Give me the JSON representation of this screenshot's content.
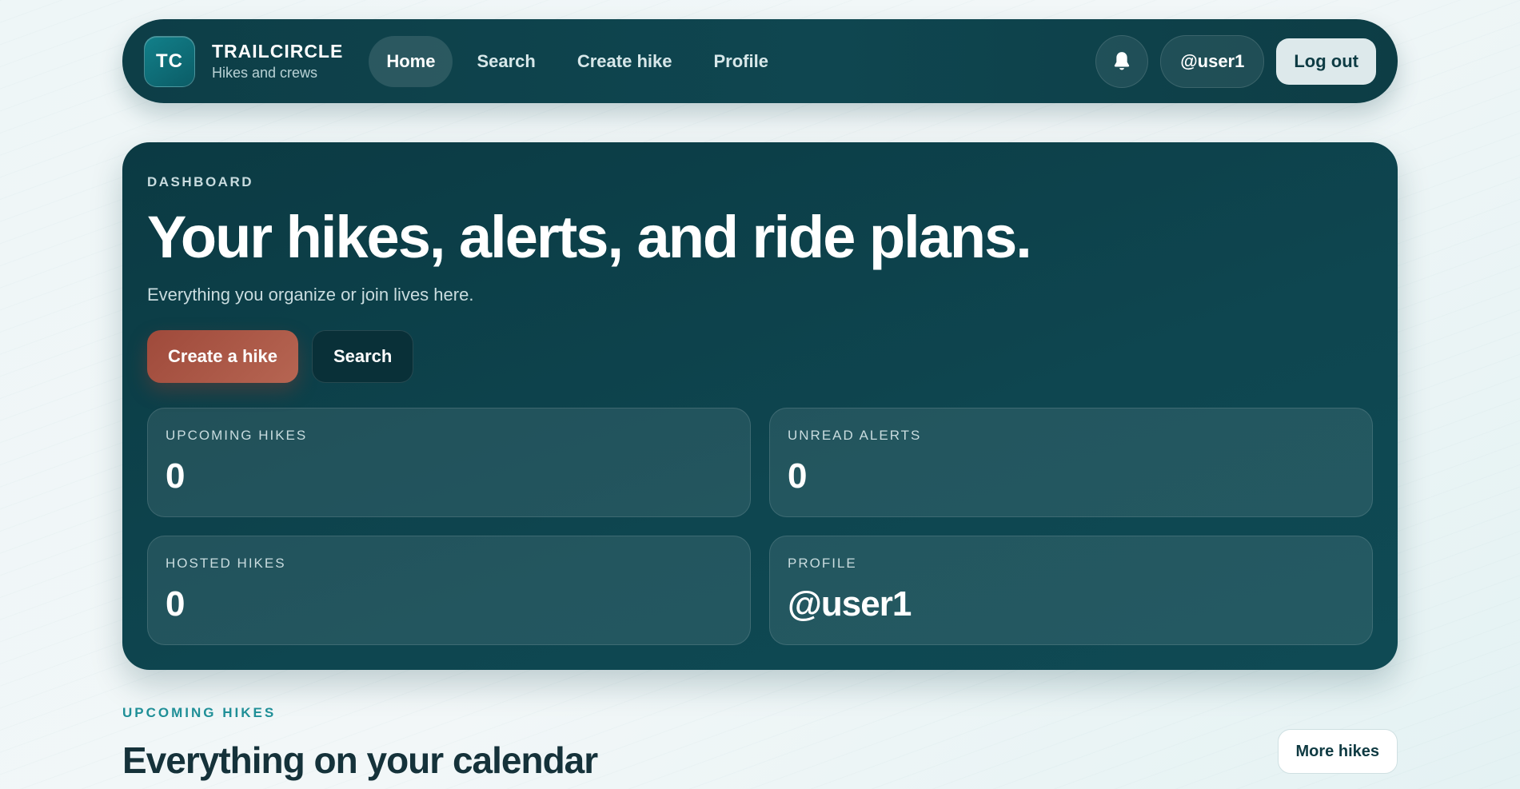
{
  "nav": {
    "logo_initials": "TC",
    "brand_name": "TRAILCIRCLE",
    "brand_sub": "Hikes and crews",
    "links": [
      {
        "label": "Home",
        "active": true
      },
      {
        "label": "Search",
        "active": false
      },
      {
        "label": "Create hike",
        "active": false
      },
      {
        "label": "Profile",
        "active": false
      }
    ],
    "bell_icon": "bell-icon",
    "user_handle": "@user1",
    "logout_label": "Log out"
  },
  "hero": {
    "eyebrow": "DASHBOARD",
    "title": "Your hikes, alerts, and ride plans.",
    "subtitle": "Everything you organize or join lives here.",
    "primary_action": "Create a hike",
    "secondary_action": "Search",
    "stats": [
      {
        "label": "UPCOMING HIKES",
        "value": "0"
      },
      {
        "label": "UNREAD ALERTS",
        "value": "0"
      },
      {
        "label": "HOSTED HIKES",
        "value": "0"
      },
      {
        "label": "PROFILE",
        "value": "@user1"
      }
    ]
  },
  "section": {
    "eyebrow": "UPCOMING HIKES",
    "title": "Everything on your calendar",
    "more_label": "More hikes"
  },
  "colors": {
    "nav_bg": "#0d3e47",
    "hero_bg": "#0e4650",
    "primary_button": "#a85441",
    "accent_teal": "#1f8f97",
    "page_bg": "#eef6f7"
  }
}
